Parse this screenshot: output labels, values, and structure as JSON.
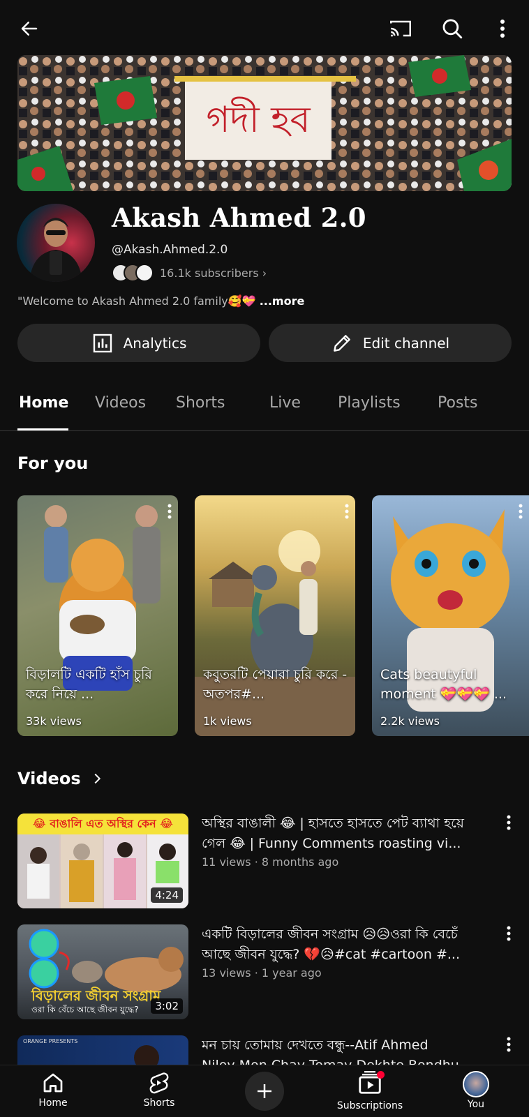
{
  "header": {
    "back_icon": "arrow-left-icon",
    "cast_icon": "cast-icon",
    "search_icon": "search-icon",
    "more_icon": "kebab-icon"
  },
  "banner": {
    "sign_text": "গদী হব"
  },
  "channel": {
    "name": "Akash Ahmed 2.0",
    "handle": "@Akash.Ahmed.2.0",
    "subscribers": "16.1k subscribers ›",
    "description": "\"Welcome to Akash Ahmed 2.0 family🥰💝",
    "more": "...more"
  },
  "actions": {
    "analytics_label": "Analytics",
    "edit_label": "Edit channel"
  },
  "tabs": [
    {
      "label": "Home",
      "active": true
    },
    {
      "label": "Videos",
      "active": false
    },
    {
      "label": "Shorts",
      "active": false
    },
    {
      "label": "Live",
      "active": false
    },
    {
      "label": "Playlists",
      "active": false
    },
    {
      "label": "Posts",
      "active": false
    }
  ],
  "for_you": {
    "heading": "For you",
    "shorts": [
      {
        "title": "বিড়ালটি একটি হাঁস চুরি করে নিয়ে ...",
        "views": "33k views"
      },
      {
        "title": "কবুতরটি পেয়ারা চুরি করে - অতপর#...",
        "views": "1k views"
      },
      {
        "title": "Cats beautyful moment 💝💝💝 ...",
        "views": "2.2k views"
      }
    ]
  },
  "videos": {
    "heading": "Videos",
    "items": [
      {
        "thumb_text": "😂 বাঙালি এত অস্থির কেন 😂",
        "duration": "4:24",
        "title_line1": "অস্থির বাঙালী 😂 | হাসতে হাসতে পেট ব্যাথা হয়ে",
        "title_line2": "গেল 😂 |  Funny Comments roasting vi...",
        "meta": "11 views · 8 months ago"
      },
      {
        "thumb_text": "বিড়ালের জীবন সংগ্রাম",
        "thumb_sub": "ওরা কি বেঁচে আছে জীবন যুদ্ধে?",
        "duration": "3:02",
        "title_line1": "একটি বিড়ালের জীবন সংগ্রাম 😥😥ওরা কি বেচেঁ",
        "title_line2": "আছে জীবন যুদ্ধে?  💔😥#cat #cartoon #...",
        "meta": "13 views · 1 year ago"
      },
      {
        "thumb_text": "ORANGE PRESENTS",
        "duration": "",
        "title_line1": "মন চায় তোমায় দেখতে বন্ধু--Atif Ahmed",
        "title_line2": "Niloy Mon Chay Tomay Dekhte Bondhu",
        "meta": ""
      }
    ]
  },
  "bottom_nav": [
    {
      "label": "Home",
      "icon": "home-icon"
    },
    {
      "label": "Shorts",
      "icon": "shorts-icon"
    },
    {
      "label": "",
      "icon": "create-plus-icon"
    },
    {
      "label": "Subscriptions",
      "icon": "subscriptions-icon"
    },
    {
      "label": "You",
      "icon": "you-avatar-icon"
    }
  ],
  "colors": {
    "background": "#0f0f0f",
    "pill": "#272727",
    "secondary_text": "#aaaaaa",
    "badge_red": "#ff0033"
  }
}
